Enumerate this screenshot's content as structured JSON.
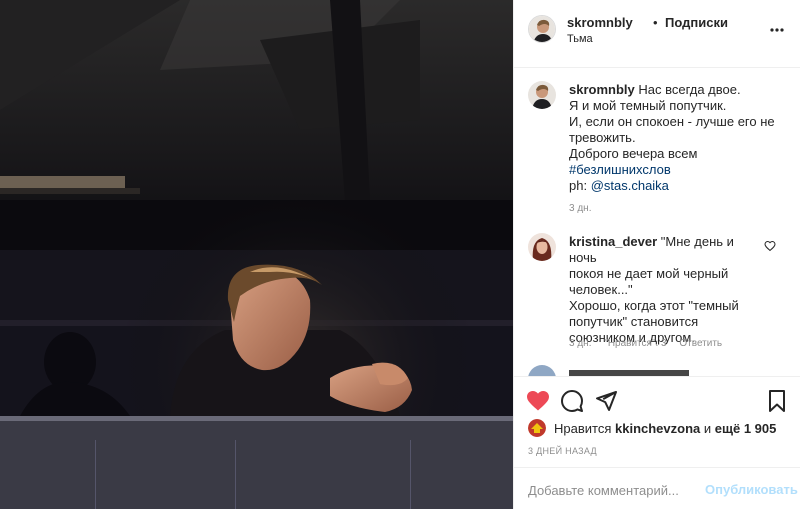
{
  "post": {
    "username": "skromnbly",
    "dot": "•",
    "follow_label": "Подписки",
    "location": "Тьма"
  },
  "caption": {
    "username": "skromnbly",
    "lines": [
      "Нас всегда двое.",
      "Я и мой темный попутчик.",
      "И, если он спокоен - лучше его не",
      "тревожить.",
      "Доброго вечера всем"
    ],
    "hashtag": "#безлишнихслов",
    "credit_prefix": "ph: ",
    "credit_mention": "@stas.chaika",
    "time": "3 дн."
  },
  "comment": {
    "username": "kristina_dever",
    "line1": "\"Мне день и ночь",
    "line2": "покоя не дает мой черный",
    "line3": "человек...\"",
    "line4": "Хорошо, когда этот \"темный",
    "line5": "попутчик\" становится",
    "line6": "союзником и другом.",
    "time": "3 дн.",
    "likes": "\"Нравится\": 3",
    "reply": "Ответить"
  },
  "likes": {
    "prefix": "Нравится",
    "user": "kkinchevzona",
    "conj": "и",
    "more": "ещё 1 905"
  },
  "time_ago": "3 дней назад",
  "add_comment": {
    "placeholder": "Добавьте комментарий...",
    "publish": "Опубликовать"
  },
  "icons": {
    "more": "more-icon",
    "like": "heart-filled-icon",
    "comment": "comment-icon",
    "share": "share-icon",
    "save": "bookmark-icon",
    "comment_like": "heart-outline-icon"
  },
  "colors": {
    "heart": "#ed4956",
    "link": "#00376b",
    "publish_disabled": "#b2dffc",
    "muted": "#8e8e8e"
  }
}
